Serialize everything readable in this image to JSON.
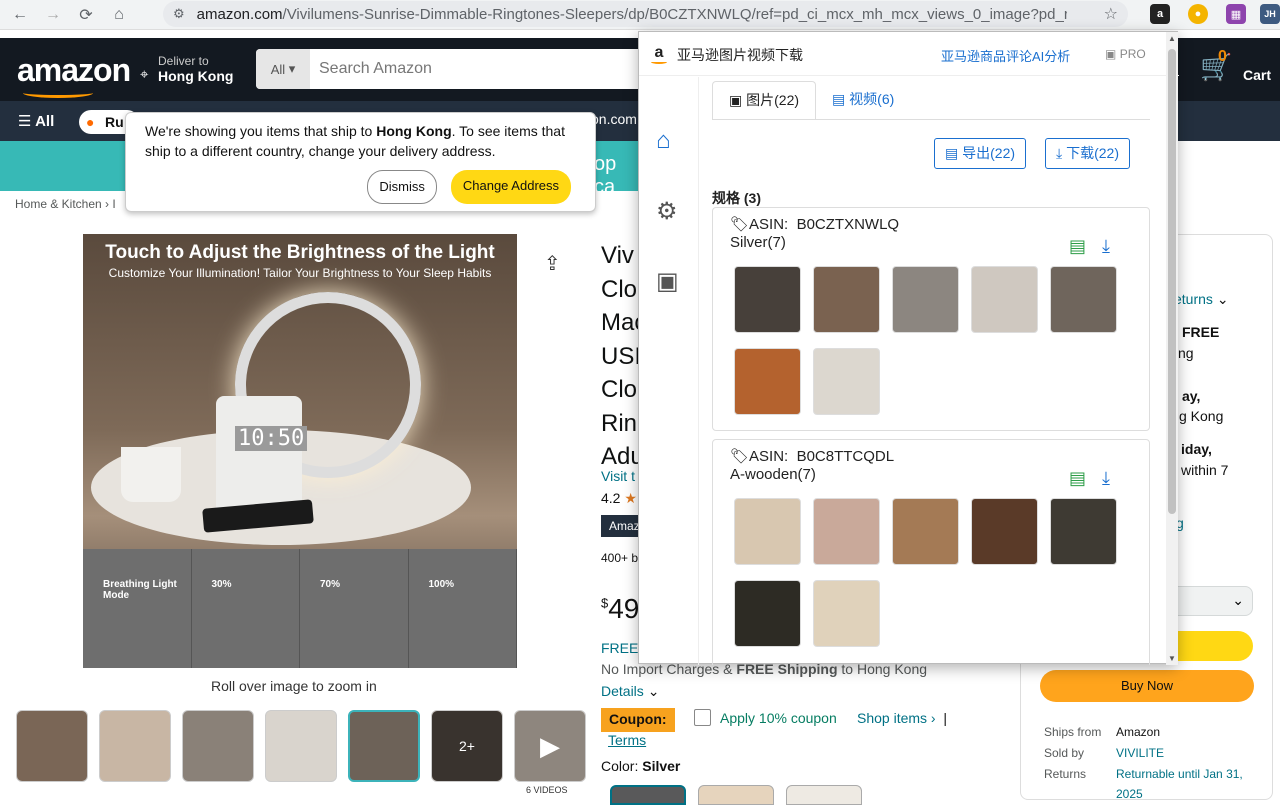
{
  "browser": {
    "url_host": "amazon.com",
    "url_path": "/Vivilumens-Sunrise-Dimmable-Ringtones-Sleepers/dp/B0CZTXNWLQ/ref=pd_ci_mcx_mh_mcx_views_0_image?pd_rd_...",
    "ext_label": "JH"
  },
  "amazon": {
    "logo": "amazon",
    "deliver_to": "Deliver to",
    "location": "Hong Kong",
    "search_scope": "All",
    "search_placeholder": "Search Amazon",
    "cart_count": "0",
    "cart_label": "Cart",
    "header_frag": "s",
    "nav_all": "All",
    "nav_rufus": "Ru",
    "nav_frag": "on.com",
    "banner_frag": "op ca",
    "breadcrumb": "Home & Kitchen  ›  I"
  },
  "tooltip": {
    "text_before": "We're showing you items that ship to ",
    "text_bold": "Hong Kong",
    "text_after": ". To see items that ship to a different country, change your delivery address.",
    "dismiss": "Dismiss",
    "change": "Change Address"
  },
  "product": {
    "img_heading": "Touch to Adjust the Brightness of the Light",
    "img_sub": "Customize Your Illumination! Tailor Your Brightness to Your Sleep Habits",
    "clock_digits": "10:50",
    "panels": [
      "Breathing Light Mode",
      "30%",
      "70%",
      "100%"
    ],
    "zoom_hint": "Roll over image to zoom in",
    "thumb_more": "2+",
    "videos_label": "6 VIDEOS",
    "title_frag_lines": [
      "Viv",
      "Clo",
      "Mac",
      "USI",
      "Clo",
      "Rin",
      "Adu"
    ],
    "visit": "Visit t",
    "rating": "4.2",
    "badge": "Amaz",
    "bought": "400+ b",
    "price_symbol": "$",
    "price_whole": "49",
    "free": "FREE",
    "import_prefix": "No Import Charges & ",
    "import_bold": "FREE Shipping",
    "import_suffix": " to Hong Kong",
    "details": "Details",
    "coupon": "Coupon:",
    "coupon_text": "Apply 10% coupon",
    "shop_items": "Shop items ›",
    "sep": "|",
    "terms": "Terms",
    "color_label": "Color: ",
    "color_value": "Silver"
  },
  "buybox": {
    "returns": "eturns",
    "free": "FREE",
    "ng": "ng",
    "ay": "ay,",
    "g_kong": "g Kong",
    "iday": "iday,",
    "within": "within 7",
    "g_link": "g",
    "buy_now": "Buy Now",
    "rows": [
      {
        "k": "Ships from",
        "v": "Amazon"
      },
      {
        "k": "Sold by",
        "v": "VIVILITE"
      },
      {
        "k": "Returns",
        "v": "Returnable until Jan 31, 2025"
      }
    ]
  },
  "popup": {
    "title": "亚马逊图片视频下载",
    "ai_link": "亚马逊商品评论AI分析",
    "pro": "PRO",
    "tab_images": "图片(22)",
    "tab_videos": "视频(6)",
    "export_btn": "导出(22)",
    "download_btn": "下载(22)",
    "section": "规格 (3)",
    "cards": [
      {
        "asin_label": "ASIN:",
        "asin": "B0CZTXNWLQ",
        "variant": "Silver(7)"
      },
      {
        "asin_label": "ASIN:",
        "asin": "B0C8TTCQDL",
        "variant": "A-wooden(7)"
      }
    ]
  },
  "colors": {
    "amazon_dark": "#131921",
    "amazon_nav": "#232f3e",
    "amazon_orange": "#ff9900",
    "link_blue": "#1a6fcf",
    "buy_yellow": "#ffd814",
    "buy_orange": "#ffa41c"
  }
}
